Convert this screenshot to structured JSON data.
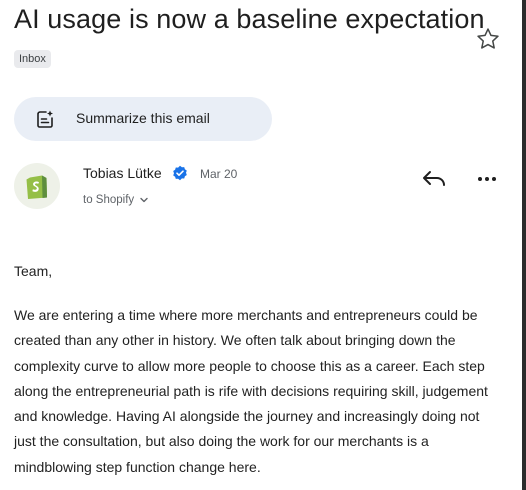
{
  "email": {
    "subject": "AI usage is now a baseline expectation",
    "label": "Inbox",
    "summarize_label": "Summarize this email",
    "sender": {
      "name": "Tobias Lütke",
      "date": "Mar 20",
      "recipient": "to Shopify",
      "avatar": "shopify-logo"
    },
    "body": {
      "greeting": "Team,",
      "paragraph": "We are entering a time where more merchants and entrepreneurs could be created than any other in history. We often talk about bringing down the complexity curve to allow more people to choose this as a career. Each step along the entrepreneurial path is rife with decisions requiring skill, judgement and knowledge. Having AI alongside the journey and increasingly doing not just the consultation, but also doing the work for our merchants is a mindblowing step function change here."
    }
  },
  "icons": {
    "star": "star-outline-icon",
    "summarize": "summarize-sparkle-icon",
    "verified": "verified-badge-icon",
    "reply": "reply-arrow-icon",
    "more": "more-horizontal-icon",
    "chevron": "chevron-down-icon"
  },
  "colors": {
    "summarize_bg": "#e9eef6",
    "verified_blue": "#1a73e8",
    "shopify_green": "#95bf47",
    "chip_bg": "#e9eaed"
  }
}
